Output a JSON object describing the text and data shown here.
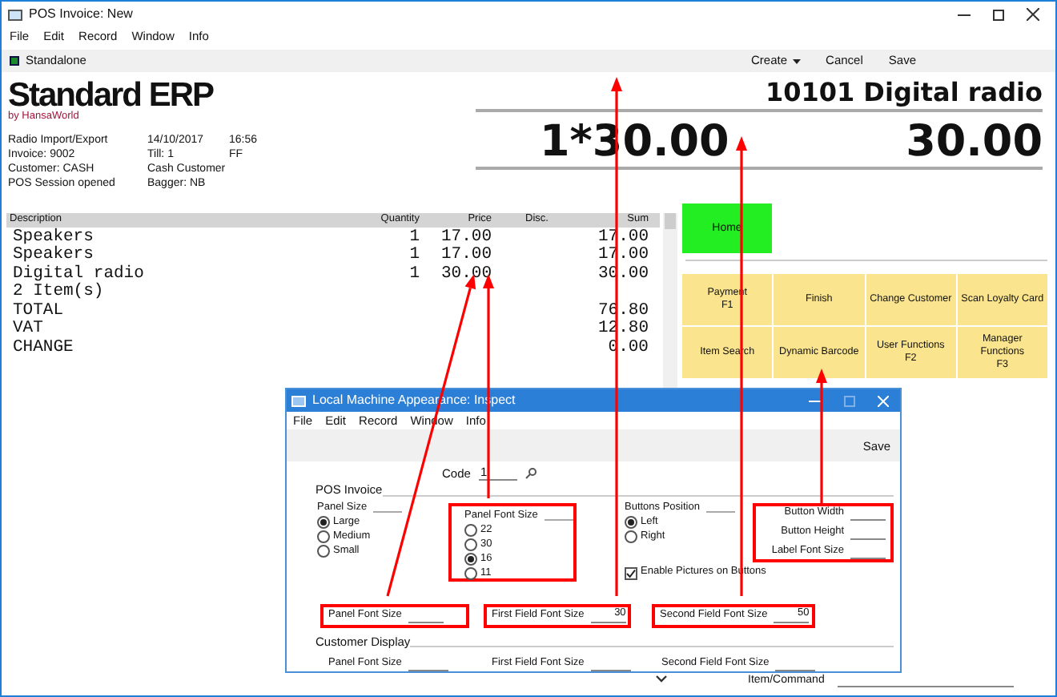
{
  "window": {
    "title": "POS Invoice: New",
    "menu": [
      "File",
      "Edit",
      "Record",
      "Window",
      "Info"
    ],
    "status": "Standalone",
    "toolbar_buttons": [
      {
        "label": "Create",
        "kind": "dropdown"
      },
      {
        "label": "Cancel",
        "kind": "plain"
      },
      {
        "label": "Save",
        "kind": "plain"
      }
    ]
  },
  "logo": {
    "name": "Standard ERP",
    "byline": "by HansaWorld"
  },
  "info": [
    [
      "Radio Import/Export",
      "14/10/2017",
      "16:56"
    ],
    [
      "Invoice: 9002",
      "Till: 1",
      "FF"
    ],
    [
      "Customer: CASH",
      "Cash Customer"
    ],
    [
      "POS Session opened",
      "Bagger: NB"
    ]
  ],
  "display": {
    "item": "10101 Digital radio",
    "quantity_price": "1*30.00",
    "amount": "30.00"
  },
  "table": {
    "columns": [
      "Description",
      "Quantity",
      "Price",
      "Disc.",
      "Sum"
    ],
    "rows": [
      {
        "description": "Speakers",
        "quantity": "1",
        "price": "17.00",
        "sum": "17.00"
      },
      {
        "description": "Speakers",
        "quantity": "1",
        "price": "17.00",
        "sum": "17.00"
      },
      {
        "description": "Digital radio",
        "quantity": "1",
        "price": "30.00",
        "sum": "30.00"
      },
      {
        "description": "2 Item(s)"
      },
      {
        "description": "TOTAL",
        "sum": "76.80"
      },
      {
        "description": "VAT",
        "sum": "12.80"
      },
      {
        "description": "CHANGE",
        "sum": "0.00"
      }
    ]
  },
  "home_button": {
    "label": "Home"
  },
  "function_buttons": [
    {
      "lines": [
        "Payment",
        "F1"
      ]
    },
    {
      "lines": [
        "Finish"
      ]
    },
    {
      "lines": [
        "Change Customer"
      ]
    },
    {
      "lines": [
        "Scan Loyalty Card"
      ]
    },
    {
      "lines": [
        "Item Search"
      ]
    },
    {
      "lines": [
        "Dynamic Barcode"
      ]
    },
    {
      "lines": [
        "User Functions",
        "F2"
      ]
    },
    {
      "lines": [
        "Manager",
        "Functions",
        "F3"
      ]
    }
  ],
  "item_command": {
    "label": "Item/Command"
  },
  "dialog": {
    "title": "Local Machine Appearance: Inspect",
    "menu": [
      "File",
      "Edit",
      "Record",
      "Window",
      "Info"
    ],
    "save": "Save",
    "code": {
      "label": "Code",
      "value": "1"
    },
    "pos_invoice": {
      "heading": "POS Invoice",
      "panel_size": {
        "label": "Panel Size",
        "options": [
          {
            "label": "Large",
            "selected": true
          },
          {
            "label": "Medium",
            "selected": false
          },
          {
            "label": "Small",
            "selected": false
          }
        ]
      },
      "panel_font_size": {
        "label": "Panel Font Size",
        "options": [
          {
            "label": "22",
            "selected": false
          },
          {
            "label": "30",
            "selected": false
          },
          {
            "label": "16",
            "selected": true
          },
          {
            "label": "11",
            "selected": false
          }
        ]
      },
      "buttons_position": {
        "label": "Buttons Position",
        "options": [
          {
            "label": "Left",
            "selected": true
          },
          {
            "label": "Right",
            "selected": false
          }
        ]
      },
      "button_fields": [
        {
          "label": "Button Width"
        },
        {
          "label": "Button Height"
        },
        {
          "label": "Label Font Size"
        }
      ],
      "enable_pictures": {
        "label": "Enable Pictures on Buttons",
        "checked": true
      },
      "font_fields": [
        {
          "label": "Panel Font Size"
        },
        {
          "label": "First Field Font Size",
          "value": "30"
        },
        {
          "label": "Second Field Font Size",
          "value": "50"
        }
      ]
    },
    "customer_display": {
      "heading": "Customer Display",
      "font_fields": [
        {
          "label": "Panel Font Size"
        },
        {
          "label": "First Field Font Size"
        },
        {
          "label": "Second Field Font Size"
        }
      ]
    }
  }
}
